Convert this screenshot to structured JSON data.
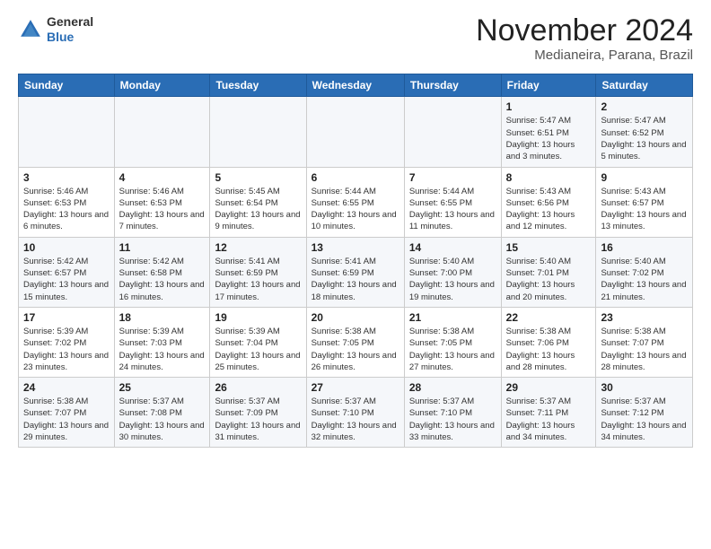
{
  "logo": {
    "general": "General",
    "blue": "Blue"
  },
  "title": "November 2024",
  "location": "Medianeira, Parana, Brazil",
  "weekdays": [
    "Sunday",
    "Monday",
    "Tuesday",
    "Wednesday",
    "Thursday",
    "Friday",
    "Saturday"
  ],
  "weeks": [
    [
      {
        "day": "",
        "info": ""
      },
      {
        "day": "",
        "info": ""
      },
      {
        "day": "",
        "info": ""
      },
      {
        "day": "",
        "info": ""
      },
      {
        "day": "",
        "info": ""
      },
      {
        "day": "1",
        "info": "Sunrise: 5:47 AM\nSunset: 6:51 PM\nDaylight: 13 hours and 3 minutes."
      },
      {
        "day": "2",
        "info": "Sunrise: 5:47 AM\nSunset: 6:52 PM\nDaylight: 13 hours and 5 minutes."
      }
    ],
    [
      {
        "day": "3",
        "info": "Sunrise: 5:46 AM\nSunset: 6:53 PM\nDaylight: 13 hours and 6 minutes."
      },
      {
        "day": "4",
        "info": "Sunrise: 5:46 AM\nSunset: 6:53 PM\nDaylight: 13 hours and 7 minutes."
      },
      {
        "day": "5",
        "info": "Sunrise: 5:45 AM\nSunset: 6:54 PM\nDaylight: 13 hours and 9 minutes."
      },
      {
        "day": "6",
        "info": "Sunrise: 5:44 AM\nSunset: 6:55 PM\nDaylight: 13 hours and 10 minutes."
      },
      {
        "day": "7",
        "info": "Sunrise: 5:44 AM\nSunset: 6:55 PM\nDaylight: 13 hours and 11 minutes."
      },
      {
        "day": "8",
        "info": "Sunrise: 5:43 AM\nSunset: 6:56 PM\nDaylight: 13 hours and 12 minutes."
      },
      {
        "day": "9",
        "info": "Sunrise: 5:43 AM\nSunset: 6:57 PM\nDaylight: 13 hours and 13 minutes."
      }
    ],
    [
      {
        "day": "10",
        "info": "Sunrise: 5:42 AM\nSunset: 6:57 PM\nDaylight: 13 hours and 15 minutes."
      },
      {
        "day": "11",
        "info": "Sunrise: 5:42 AM\nSunset: 6:58 PM\nDaylight: 13 hours and 16 minutes."
      },
      {
        "day": "12",
        "info": "Sunrise: 5:41 AM\nSunset: 6:59 PM\nDaylight: 13 hours and 17 minutes."
      },
      {
        "day": "13",
        "info": "Sunrise: 5:41 AM\nSunset: 6:59 PM\nDaylight: 13 hours and 18 minutes."
      },
      {
        "day": "14",
        "info": "Sunrise: 5:40 AM\nSunset: 7:00 PM\nDaylight: 13 hours and 19 minutes."
      },
      {
        "day": "15",
        "info": "Sunrise: 5:40 AM\nSunset: 7:01 PM\nDaylight: 13 hours and 20 minutes."
      },
      {
        "day": "16",
        "info": "Sunrise: 5:40 AM\nSunset: 7:02 PM\nDaylight: 13 hours and 21 minutes."
      }
    ],
    [
      {
        "day": "17",
        "info": "Sunrise: 5:39 AM\nSunset: 7:02 PM\nDaylight: 13 hours and 23 minutes."
      },
      {
        "day": "18",
        "info": "Sunrise: 5:39 AM\nSunset: 7:03 PM\nDaylight: 13 hours and 24 minutes."
      },
      {
        "day": "19",
        "info": "Sunrise: 5:39 AM\nSunset: 7:04 PM\nDaylight: 13 hours and 25 minutes."
      },
      {
        "day": "20",
        "info": "Sunrise: 5:38 AM\nSunset: 7:05 PM\nDaylight: 13 hours and 26 minutes."
      },
      {
        "day": "21",
        "info": "Sunrise: 5:38 AM\nSunset: 7:05 PM\nDaylight: 13 hours and 27 minutes."
      },
      {
        "day": "22",
        "info": "Sunrise: 5:38 AM\nSunset: 7:06 PM\nDaylight: 13 hours and 28 minutes."
      },
      {
        "day": "23",
        "info": "Sunrise: 5:38 AM\nSunset: 7:07 PM\nDaylight: 13 hours and 28 minutes."
      }
    ],
    [
      {
        "day": "24",
        "info": "Sunrise: 5:38 AM\nSunset: 7:07 PM\nDaylight: 13 hours and 29 minutes."
      },
      {
        "day": "25",
        "info": "Sunrise: 5:37 AM\nSunset: 7:08 PM\nDaylight: 13 hours and 30 minutes."
      },
      {
        "day": "26",
        "info": "Sunrise: 5:37 AM\nSunset: 7:09 PM\nDaylight: 13 hours and 31 minutes."
      },
      {
        "day": "27",
        "info": "Sunrise: 5:37 AM\nSunset: 7:10 PM\nDaylight: 13 hours and 32 minutes."
      },
      {
        "day": "28",
        "info": "Sunrise: 5:37 AM\nSunset: 7:10 PM\nDaylight: 13 hours and 33 minutes."
      },
      {
        "day": "29",
        "info": "Sunrise: 5:37 AM\nSunset: 7:11 PM\nDaylight: 13 hours and 34 minutes."
      },
      {
        "day": "30",
        "info": "Sunrise: 5:37 AM\nSunset: 7:12 PM\nDaylight: 13 hours and 34 minutes."
      }
    ]
  ]
}
